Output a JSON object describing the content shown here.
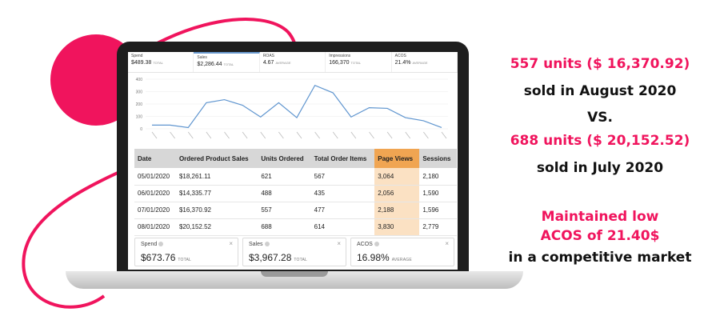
{
  "colors": {
    "accent": "#f0145d",
    "highlight_column": "#f0a552",
    "highlight_cell": "#fbe1c3"
  },
  "metrics_tabs": [
    {
      "label": "Spend",
      "value": "$489.38",
      "sub": "TOTAL"
    },
    {
      "label": "Sales",
      "value": "$2,286.44",
      "sub": "TOTAL"
    },
    {
      "label": "ROAS",
      "value": "4.67",
      "sub": "AVERAGE"
    },
    {
      "label": "Impressions",
      "value": "166,370",
      "sub": "TOTAL"
    },
    {
      "label": "ACOS",
      "value": "21.4%",
      "sub": "AVERAGE"
    }
  ],
  "chart_data": {
    "type": "line",
    "yticks": [
      "400",
      "300",
      "200",
      "100",
      "0"
    ],
    "ylim": [
      0,
      400
    ],
    "series": [
      {
        "values": [
          30,
          30,
          10,
          210,
          235,
          190,
          95,
          210,
          90,
          350,
          290,
          95,
          170,
          165,
          90,
          65,
          10
        ]
      }
    ],
    "grid": true
  },
  "table": {
    "headers": [
      "Date",
      "Ordered Product Sales",
      "Units Ordered",
      "Total Order Items",
      "Page Views",
      "Sessions"
    ],
    "rows": [
      [
        "05/01/2020",
        "$18,261.11",
        "621",
        "567",
        "3,064",
        "2,180"
      ],
      [
        "06/01/2020",
        "$14,335.77",
        "488",
        "435",
        "2,056",
        "1,590"
      ],
      [
        "07/01/2020",
        "$16,370.92",
        "557",
        "477",
        "2,188",
        "1,596"
      ],
      [
        "08/01/2020",
        "$20,152.52",
        "688",
        "614",
        "3,830",
        "2,779"
      ]
    ]
  },
  "cards": [
    {
      "label": "Spend",
      "value": "$673.76",
      "sub": "TOTAL",
      "close": "×"
    },
    {
      "label": "Sales",
      "value": "$3,967.28",
      "sub": "TOTAL",
      "close": "×"
    },
    {
      "label": "ACOS",
      "value": "16.98%",
      "sub": "AVERAGE",
      "close": "×"
    }
  ],
  "copy": {
    "line1": "557 units ($ 16,370.92)",
    "line2": "sold in August 2020",
    "line3": "VS.",
    "line4": "688 units ($ 20,152.52)",
    "line5": "sold in July 2020",
    "line6": "Maintained low",
    "line7": "ACOS of 21.40$",
    "line8": "in a competitive market"
  }
}
